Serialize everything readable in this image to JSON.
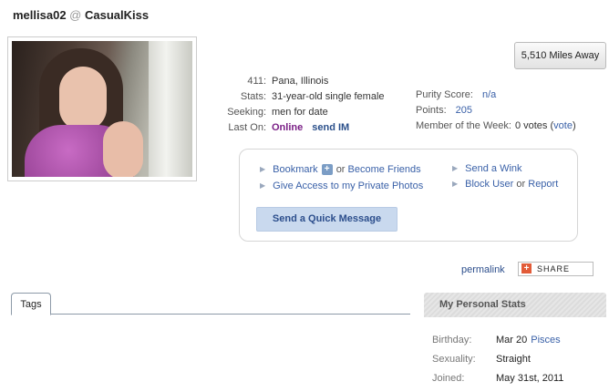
{
  "header": {
    "username": "mellisa02",
    "at": "@",
    "site": "CasualKiss"
  },
  "distance_button": "5,510 Miles Away",
  "profile": {
    "rows": [
      {
        "label": "411:",
        "value": "Pana, Illinois"
      },
      {
        "label": "Stats:",
        "value": "31-year-old single female"
      },
      {
        "label": "Seeking:",
        "value": "men for date"
      }
    ],
    "last_on_label": "Last On:",
    "online_status": "Online",
    "send_im": "send IM",
    "purity_label": "Purity Score:",
    "purity_value": "n/a",
    "points_label": "Points:",
    "points_value": "205",
    "motw_label": "Member of the Week:",
    "motw_votes": "0 votes",
    "motw_vote_link": "vote"
  },
  "actions": {
    "bookmark": "Bookmark",
    "plus_glyph": "+",
    "or": "or",
    "become_friends": "Become Friends",
    "private_photos": "Give Access to my Private Photos",
    "send_wink": "Send a Wink",
    "block_user": "Block User",
    "report": "Report",
    "quick_message": "Send a Quick Message",
    "bullet": "▶"
  },
  "permalink": "permalink",
  "share": {
    "plus": "+",
    "label": "SHARE"
  },
  "tags_tab": "Tags",
  "personal_stats": {
    "title": "My Personal Stats",
    "birthday_label": "Birthday:",
    "birthday_value": "Mar 20",
    "birthday_sign": "Pisces",
    "sexuality_label": "Sexuality:",
    "sexuality_value": "Straight",
    "joined_label": "Joined:",
    "joined_value": "May 31st, 2011"
  },
  "colors": {
    "link": "#3a61a8",
    "online": "#7a1f86",
    "quick_message_bg": "#c9d9ee",
    "share_plus": "#e25b38"
  }
}
